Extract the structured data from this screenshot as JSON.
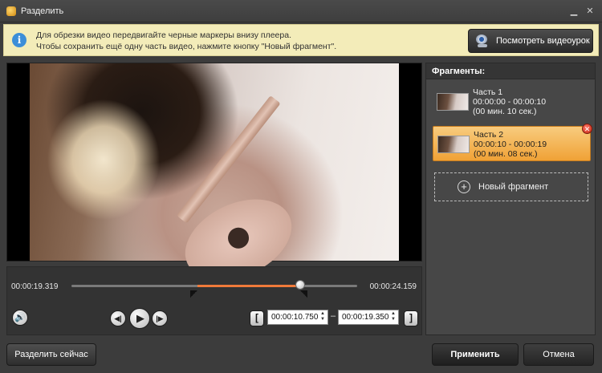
{
  "window": {
    "title": "Разделить",
    "close_symbol": "✕",
    "minimize_symbol": "▁"
  },
  "banner": {
    "line1": "Для обрезки видео передвигайте черные маркеры внизу плеера.",
    "line2": "Чтобы сохранить ещё одну часть видео, нажмите кнопку \"Новый фрагмент\".",
    "info_symbol": "i",
    "tutorial_button": "Посмотреть видеоурок"
  },
  "timeline": {
    "start_time": "00:00:19.319",
    "end_time": "00:00:24.159",
    "selection_start_fraction": 0.44,
    "selection_end_fraction": 0.8,
    "playhead_fraction": 0.8,
    "mark_in_value": "00:00:10.750",
    "mark_out_value": "00:00:19.350",
    "dash": "–",
    "volume_symbol": "🔊",
    "prev_symbol": "◀|",
    "play_symbol": "▶",
    "next_symbol": "|▶",
    "mark_in_symbol": "[",
    "mark_out_symbol": "]",
    "spin_up": "▲",
    "spin_down": "▼"
  },
  "fragments": {
    "header": "Фрагменты:",
    "items": [
      {
        "name": "Часть 1",
        "range": "00:00:00 - 00:00:10",
        "duration": "(00 мин. 10 сек.)",
        "selected": false
      },
      {
        "name": "Часть 2",
        "range": "00:00:10 - 00:00:19",
        "duration": "(00 мин. 08 сек.)",
        "selected": true
      }
    ],
    "delete_symbol": "✕",
    "new_fragment": "Новый фрагмент",
    "plus_symbol": "+"
  },
  "buttons": {
    "split_now": "Разделить сейчас",
    "apply": "Применить",
    "cancel": "Отмена"
  },
  "colors": {
    "accent_orange": "#f07a3a",
    "selected_fragment": "#f0a236",
    "banner_bg": "#f3ecb9"
  }
}
